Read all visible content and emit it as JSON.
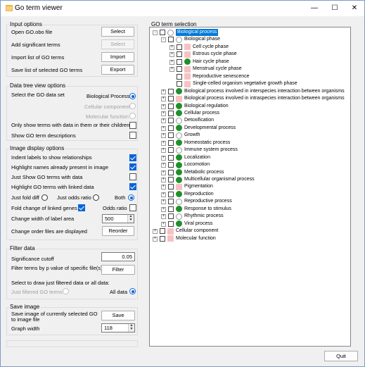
{
  "window": {
    "title": "Go term viewer",
    "minimize_glyph": "—",
    "maximize_glyph": "☐",
    "close_glyph": "✕"
  },
  "input_options": {
    "title": "Input options",
    "open_label": "Open GO.obo file",
    "open_btn": "Select",
    "sig_label": "Add significant terms",
    "sig_btn": "Select",
    "import_label": "Import list of GO terms",
    "import_btn": "Import",
    "export_label": "Save list of selected GO terms",
    "export_btn": "Export"
  },
  "data_tree": {
    "title": "Data tree view options",
    "select_label": "Select the GO data set",
    "opt_bp": "Biological Process",
    "opt_cc": "Cellular component",
    "opt_mf": "Molecular function",
    "only_show": "Only show terms with data in them or their children",
    "show_desc": "Show GO term descriptions"
  },
  "image_display": {
    "title": "Image display options",
    "indent": "Indent labels to show relationships",
    "highlight_names": "Highlight names already present in image",
    "just_show": "Just Show GO terms with data",
    "highlight_linked": "Highlight GO terms with linked data",
    "fold_diff": "Just fold diff",
    "odds_ratio": "Just odds ratio",
    "both": "Both",
    "fold_change": "Fold change of linked genes",
    "odds_ratio_cb": "Odds ratio",
    "change_width": "Change width of label area",
    "width_value": "500",
    "change_order": "Change order files are displayed",
    "reorder_btn": "Reorder"
  },
  "filter": {
    "title": "Filter data",
    "sig_cutoff": "Significance cutoff",
    "sig_value": "0.05",
    "filter_label": "Filter terms by p value of specific file(s)",
    "filter_btn": "Filter",
    "draw_label": "Select to draw just filtered data or all data:",
    "just_filtered": "Just filtered GO terms",
    "all_data": "All data"
  },
  "save_image": {
    "title": "Save image",
    "save_label_1": "Save image of currently selected GO",
    "save_label_2": "to image file",
    "save_btn": "Save",
    "graph_width": "Graph width",
    "graph_width_value": "118"
  },
  "tree": {
    "title": "GO term selection",
    "nodes": [
      {
        "label": "Biological process",
        "exp": "-",
        "dot": "white",
        "selected": true
      },
      {
        "label": "Biological phase",
        "exp": "-",
        "dot": "white"
      },
      {
        "label": "Cell cycle phase",
        "exp": "+",
        "dot": "pink"
      },
      {
        "label": "Estrous cycle phase",
        "exp": "+",
        "dot": "pink"
      },
      {
        "label": "Hair cycle phase",
        "exp": "+",
        "dot": "green"
      },
      {
        "label": "Menstrual cycle phase",
        "exp": "+",
        "dot": "pink"
      },
      {
        "label": "Reproductive senescence",
        "exp": "",
        "dot": "pink"
      },
      {
        "label": "Single-celled organism vegetative growth phase",
        "exp": "",
        "dot": "pink"
      },
      {
        "label": "Biological process involved in interspecies interaction between organisms",
        "exp": "+",
        "dot": "green"
      },
      {
        "label": "Biological process involved in intraspecies interaction between organisms",
        "exp": "+",
        "dot": "pink"
      },
      {
        "label": "Biological regulation",
        "exp": "+",
        "dot": "green"
      },
      {
        "label": "Cellular process",
        "exp": "+",
        "dot": "green"
      },
      {
        "label": "Detoxification",
        "exp": "+",
        "dot": "white"
      },
      {
        "label": "Developmental process",
        "exp": "+",
        "dot": "green"
      },
      {
        "label": "Growth",
        "exp": "+",
        "dot": "white"
      },
      {
        "label": "Homeostatic process",
        "exp": "+",
        "dot": "green"
      },
      {
        "label": "Immune system process",
        "exp": "+",
        "dot": "white"
      },
      {
        "label": "Localization",
        "exp": "+",
        "dot": "green"
      },
      {
        "label": "Locomotion",
        "exp": "+",
        "dot": "green"
      },
      {
        "label": "Metabolic process",
        "exp": "+",
        "dot": "green"
      },
      {
        "label": "Multicellular organismal process",
        "exp": "+",
        "dot": "green"
      },
      {
        "label": "Pigmentation",
        "exp": "+",
        "dot": "pink"
      },
      {
        "label": "Reproduction",
        "exp": "+",
        "dot": "green"
      },
      {
        "label": "Reproductive process",
        "exp": "+",
        "dot": "white"
      },
      {
        "label": "Response to stimulus",
        "exp": "+",
        "dot": "green"
      },
      {
        "label": "Rhythmic process",
        "exp": "+",
        "dot": "white"
      },
      {
        "label": "Viral process",
        "exp": "+",
        "dot": "green"
      },
      {
        "label": "Cellular component",
        "exp": "+",
        "dot": "pink"
      },
      {
        "label": "Molecular function",
        "exp": "+",
        "dot": "pink"
      }
    ]
  },
  "quit_btn": "Quit",
  "colors": {
    "accent": "#0a64d8",
    "has_data": "#1f8f2a",
    "no_data": "#f6c2c2",
    "selection": "#0078d7"
  }
}
